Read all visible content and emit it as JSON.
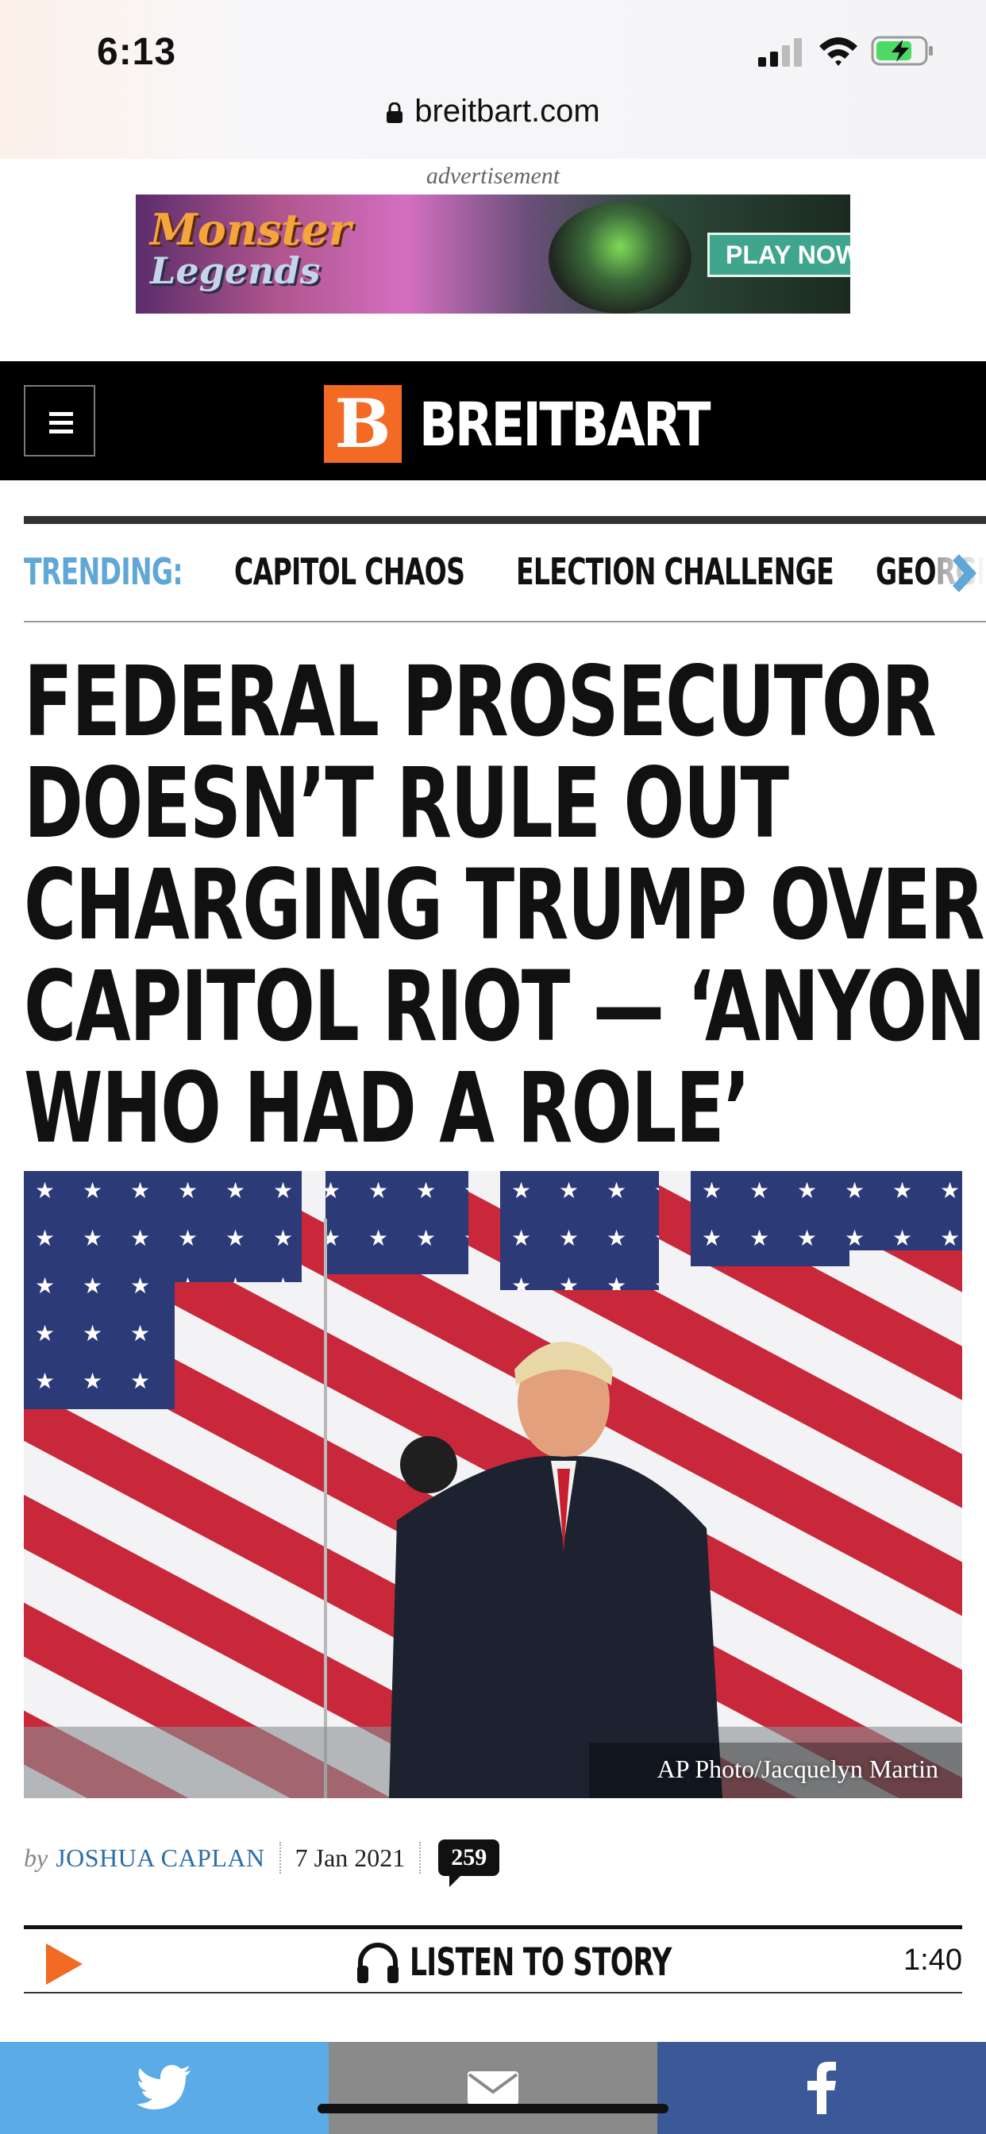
{
  "status_bar": {
    "time": "6:13",
    "url": "breitbart.com",
    "icons": [
      "signal-icon",
      "wifi-icon",
      "battery-charging-icon",
      "lock-icon"
    ]
  },
  "ad": {
    "label": "advertisement",
    "banner_title_line1": "Monster",
    "banner_title_line2": "Legends",
    "banner_button": "PLAY NOW"
  },
  "masthead": {
    "logo_letter": "B",
    "brand_name": "BREITBART",
    "menu_icon": "hamburger-icon",
    "colors": {
      "brand_orange": "#f26a24",
      "bar": "#000000"
    }
  },
  "trending": {
    "label": "TRENDING:",
    "items": [
      "CAPITOL CHAOS",
      "ELECTION CHALLENGE",
      "GEORGIA"
    ],
    "color": "#5fa7d6"
  },
  "article": {
    "headline_lines": [
      "FEDERAL PROSECUTOR",
      "DOESN’T RULE OUT",
      "CHARGING TRUMP OVER",
      "CAPITOL RIOT — ‘ANYONE",
      "WHO HAD A ROLE’"
    ],
    "photo_credit": "AP Photo/Jacquelyn Martin",
    "byline_prefix": "by",
    "author": "JOSHUA CAPLAN",
    "date": "7 Jan 2021",
    "comment_count": "259"
  },
  "listen": {
    "label": "LISTEN TO STORY",
    "duration": "1:40"
  },
  "share_bar": {
    "buttons": [
      "twitter-icon",
      "email-icon",
      "facebook-icon"
    ],
    "colors": {
      "twitter": "#5aabe6",
      "email": "#8a8a8a",
      "facebook": "#3b5998"
    }
  }
}
